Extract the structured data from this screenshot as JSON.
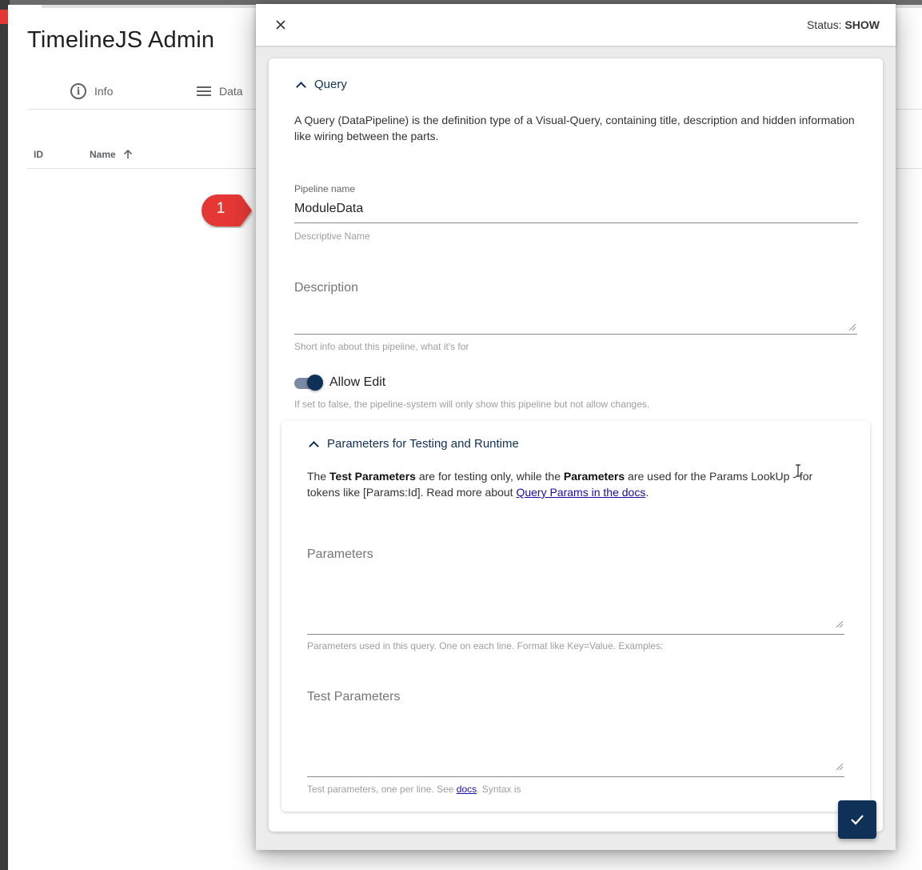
{
  "app": {
    "title": "TimelineJS Admin",
    "tabs": [
      {
        "label": "Info",
        "icon": "info-icon"
      },
      {
        "label": "Data",
        "icon": "menu-icon"
      }
    ],
    "table": {
      "columns": [
        {
          "label": "ID"
        },
        {
          "label": "Name",
          "sort_icon": "arrow-up-icon"
        }
      ]
    }
  },
  "callout": {
    "number": "1",
    "color": "#e53935"
  },
  "dialog": {
    "status_prefix": "Status: ",
    "status_value": "SHOW",
    "query_section": {
      "title": "Query",
      "description": "A Query (DataPipeline) is the definition type of a Visual-Query, containing title, description and hidden information like wiring between the parts.",
      "pipeline_name": {
        "label": "Pipeline name",
        "value": "ModuleData",
        "hint": "Descriptive Name"
      },
      "description_field": {
        "label": "Description",
        "value": "",
        "hint": "Short info about this pipeline, what it's for"
      },
      "allow_edit": {
        "label": "Allow Edit",
        "checked": true,
        "hint": "If set to false, the pipeline-system will only show this pipeline but not allow changes."
      }
    },
    "params_section": {
      "title": "Parameters for Testing and Runtime",
      "text_1": "The ",
      "bold_1": "Test Parameters",
      "text_2": " are for testing only, while the ",
      "bold_2": "Parameters",
      "text_3": " are used for the Params LookUp - for tokens like [Params:Id]. Read more about ",
      "link_text": "Query Params in the docs",
      "text_4": ".",
      "parameters": {
        "label": "Parameters",
        "value": "",
        "hint": "Parameters used in this query. One on each line. Format like Key=Value. Examples:"
      },
      "test_parameters": {
        "label": "Test Parameters",
        "value": "",
        "hint_prefix": "Test parameters, one per line. See ",
        "hint_link": "docs",
        "hint_suffix": ". Syntax is"
      }
    },
    "save_button_icon": "check-icon",
    "accent_color": "#0f3057"
  }
}
